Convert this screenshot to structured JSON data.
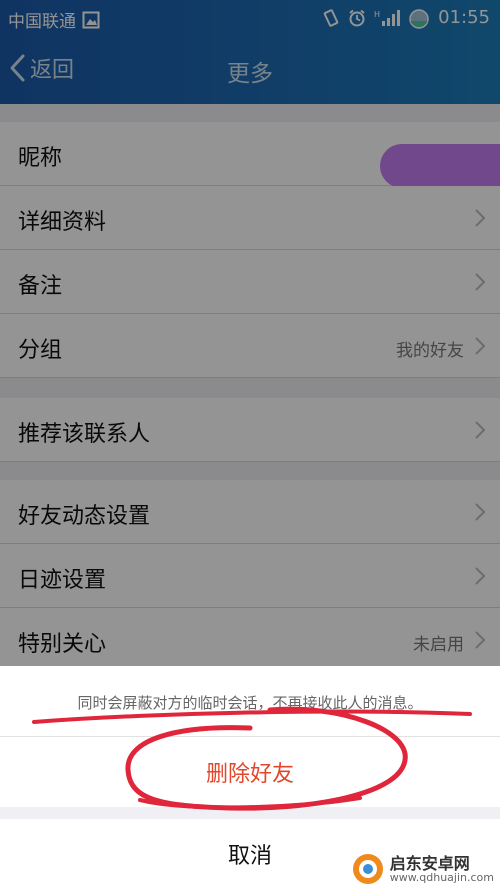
{
  "status_bar": {
    "carrier": "中国联通",
    "time": "01:55",
    "network_tag": "H",
    "icons": [
      "image-icon",
      "vibrate-icon",
      "alarm-icon",
      "signal-icon",
      "battery-icon"
    ]
  },
  "nav": {
    "back_label": "返回",
    "title": "更多"
  },
  "list": {
    "nickname": {
      "label": "昵称"
    },
    "details": {
      "label": "详细资料"
    },
    "remark": {
      "label": "备注"
    },
    "group": {
      "label": "分组",
      "value": "我的好友"
    },
    "recommend": {
      "label": "推荐该联系人"
    },
    "feed_settings": {
      "label": "好友动态设置"
    },
    "footprint_settings": {
      "label": "日迹设置"
    },
    "special_care": {
      "label": "特别关心",
      "value": "未启用"
    }
  },
  "sheet": {
    "message": "同时会屏蔽对方的临时会话，不再接收此人的消息。",
    "delete_label": "删除好友",
    "cancel_label": "取消"
  },
  "watermark": {
    "name": "启东安卓网",
    "url": "www.qdhuajin.com"
  },
  "colors": {
    "header_blue": "#1c6db3",
    "delete_red": "#e2472c",
    "annotation_red": "#e0263b",
    "privacy_purple": "#c47cf1"
  }
}
